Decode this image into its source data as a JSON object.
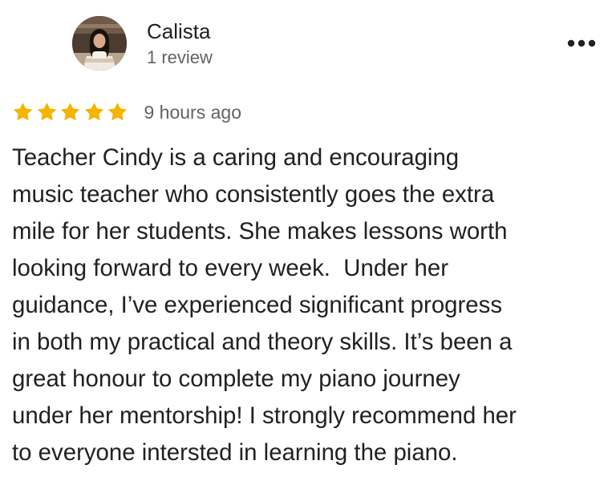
{
  "review": {
    "author": {
      "name": "Calista",
      "review_count": "1 review",
      "avatar_icon": "profile-photo-icon"
    },
    "actions": {
      "more_icon": "more-options-icon"
    },
    "rating": {
      "value": 5,
      "max": 5,
      "star_color": "#F4B400",
      "timestamp": "9 hours ago"
    },
    "text_lines": [
      "Teacher Cindy is a caring and encouraging",
      "music teacher who consistently goes the extra",
      "mile for her students. She makes lessons worth",
      "looking forward to every week.  Under her",
      "guidance, I’ve experienced significant progress",
      "in both my practical and theory skills. It’s been a",
      "great honour to complete my piano journey",
      "under her mentorship! I strongly recommend her",
      "to everyone intersted in learning the piano."
    ]
  },
  "colors": {
    "text": "#202124",
    "secondary_text": "#5F6368",
    "background": "#FFFFFF",
    "star": "#F4B400"
  }
}
